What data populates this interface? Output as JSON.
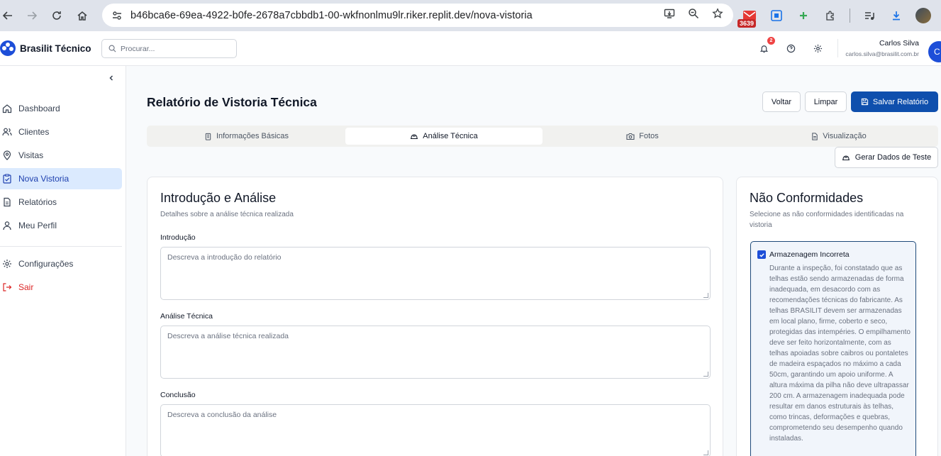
{
  "browser": {
    "url": "b46bca6e-69ea-4922-b0fe-2678a7cbbdb1-00-wkfnonlmu9lr.riker.replit.dev/nova-vistoria",
    "extension_badge": "3639"
  },
  "app": {
    "brand": "Brasilit Técnico",
    "search_placeholder": "Procurar...",
    "notifications_count": "2",
    "user": {
      "name": "Carlos Silva",
      "email": "carlos.silva@brasilit.com.br",
      "initial": "C"
    }
  },
  "sidebar": {
    "items": [
      {
        "label": "Dashboard",
        "icon": "home-icon"
      },
      {
        "label": "Clientes",
        "icon": "users-icon"
      },
      {
        "label": "Visitas",
        "icon": "map-pin-icon"
      },
      {
        "label": "Nova Vistoria",
        "icon": "clipboard-check-icon",
        "active": true
      },
      {
        "label": "Relatórios",
        "icon": "file-text-icon"
      },
      {
        "label": "Meu Perfil",
        "icon": "user-icon"
      }
    ],
    "settings_label": "Configurações",
    "logout_label": "Sair"
  },
  "page": {
    "title": "Relatório de Vistoria Técnica",
    "buttons": {
      "back": "Voltar",
      "clear": "Limpar",
      "save": "Salvar Relatório",
      "test_data": "Gerar Dados de Teste"
    },
    "tabs": [
      {
        "label": "Informações Básicas",
        "icon": "building-icon"
      },
      {
        "label": "Análise Técnica",
        "icon": "hard-hat-icon",
        "active": true
      },
      {
        "label": "Fotos",
        "icon": "camera-icon"
      },
      {
        "label": "Visualização",
        "icon": "file-icon"
      }
    ]
  },
  "analysis_card": {
    "title": "Introdução e Análise",
    "subtitle": "Detalhes sobre a análise técnica realizada",
    "fields": [
      {
        "label": "Introdução",
        "placeholder": "Descreva a introdução do relatório"
      },
      {
        "label": "Análise Técnica",
        "placeholder": "Descreva a análise técnica realizada"
      },
      {
        "label": "Conclusão",
        "placeholder": "Descreva a conclusão da análise"
      }
    ]
  },
  "nc_card": {
    "title": "Não Conformidades",
    "subtitle": "Selecione as não conformidades identificadas na vistoria",
    "item": {
      "title": "Armazenagem Incorreta",
      "checked": true,
      "text": "Durante a inspeção, foi constatado que as telhas estão sendo armazenadas de forma inadequada, em desacordo com as recomendações técnicas do fabricante. As telhas BRASILIT devem ser armazenadas em local plano, firme, coberto e seco, protegidas das intempéries. O empilhamento deve ser feito horizontalmente, com as telhas apoiadas sobre caibros ou pontaletes de madeira espaçados no máximo a cada 50cm, garantindo um apoio uniforme. A altura máxima da pilha não deve ultrapassar 200 cm. A armazenagem inadequada pode resultar em danos estruturais às telhas, como trincas, deformações e quebras, comprometendo seu desempenho quando instaladas."
    }
  }
}
